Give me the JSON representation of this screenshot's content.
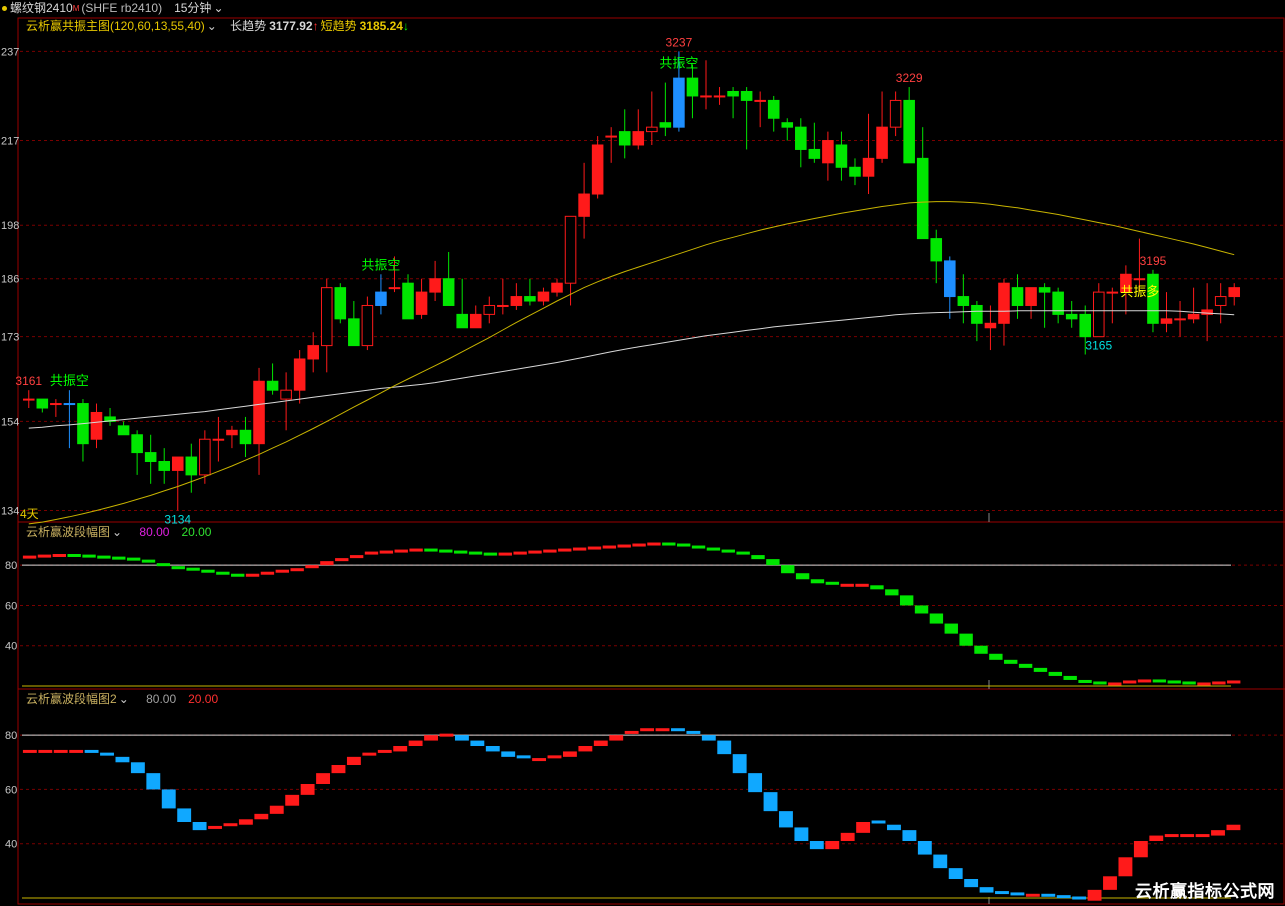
{
  "topbar": {
    "symbol": "螺纹钢2410",
    "superscript": "M",
    "code": "(SHFE rb2410)",
    "period": "15分钟"
  },
  "panel1": {
    "title": "云析赢共振主图",
    "params": "(120,60,13,55,40)",
    "long_label": "长趋势",
    "long_value": "3177.92",
    "long_arrow": "↑",
    "short_label": "短趋势",
    "short_value": "3185.24",
    "short_arrow": "↓",
    "days_label": "4天"
  },
  "panel2": {
    "title": "云析赢波段幅图",
    "v1": "80.00",
    "v2": "20.00"
  },
  "panel3": {
    "title": "云析赢波段幅图2",
    "v1": "80.00",
    "v2": "20.00"
  },
  "watermark": "云析赢指标公式网",
  "colors": {
    "up": "#ff1a1a",
    "down": "#00e600",
    "resonance": "#1e8fff",
    "long_line": "#d8d8d8",
    "short_line": "#c8b400",
    "osc2_up": "#ff1a1a",
    "osc2_dn": "#00e600",
    "osc3_up": "#ff1a1a",
    "osc3_dn": "#10a8ff",
    "grid": "#7a0000",
    "axis": "#9a0000"
  },
  "chart_data": [
    {
      "type": "candlestick",
      "title": "云析赢共振主图",
      "y_ticks": [
        3134,
        3154,
        3173,
        3186,
        3198,
        3217,
        3237
      ],
      "y_tick_labels": [
        "134",
        "154",
        "173",
        "186",
        "198",
        "217",
        "237"
      ],
      "ylim": [
        3133,
        3240
      ],
      "series": [
        {
          "name": "candles",
          "ohlc": [
            [
              3159,
              3161,
              3157,
              3159
            ],
            [
              3159,
              3159,
              3156,
              3157
            ],
            [
              3158,
              3159,
              3155,
              3158
            ],
            [
              3158,
              3161,
              3148,
              3158
            ],
            [
              3158,
              3159,
              3145,
              3149
            ],
            [
              3150,
              3158,
              3148,
              3156
            ],
            [
              3155,
              3157,
              3153,
              3154
            ],
            [
              3153,
              3154,
              3151,
              3151
            ],
            [
              3151,
              3152,
              3142,
              3147
            ],
            [
              3147,
              3151,
              3140,
              3145
            ],
            [
              3145,
              3148,
              3140,
              3143
            ],
            [
              3143,
              3146,
              3134,
              3146
            ],
            [
              3146,
              3149,
              3138,
              3142
            ],
            [
              3142,
              3152,
              3140,
              3150
            ],
            [
              3150,
              3155,
              3145,
              3150
            ],
            [
              3151,
              3153,
              3148,
              3152
            ],
            [
              3152,
              3155,
              3146,
              3149
            ],
            [
              3149,
              3166,
              3142,
              3163
            ],
            [
              3163,
              3167,
              3160,
              3161
            ],
            [
              3159,
              3165,
              3152,
              3161
            ],
            [
              3161,
              3170,
              3158,
              3168
            ],
            [
              3168,
              3174,
              3165,
              3171
            ],
            [
              3171,
              3186,
              3165,
              3184
            ],
            [
              3184,
              3185,
              3176,
              3177
            ],
            [
              3177,
              3181,
              3171,
              3171
            ],
            [
              3171,
              3182,
              3170,
              3180
            ],
            [
              3180,
              3187,
              3178,
              3183
            ],
            [
              3184,
              3191,
              3183,
              3184
            ],
            [
              3185,
              3187,
              3180,
              3177
            ],
            [
              3178,
              3186,
              3177,
              3183
            ],
            [
              3183,
              3190,
              3181,
              3186
            ],
            [
              3186,
              3192,
              3182,
              3180
            ],
            [
              3178,
              3186,
              3175,
              3175
            ],
            [
              3175,
              3180,
              3175,
              3178
            ],
            [
              3178,
              3182,
              3176,
              3180
            ],
            [
              3180,
              3186,
              3178,
              3180
            ],
            [
              3180,
              3185,
              3179,
              3182
            ],
            [
              3182,
              3186,
              3180,
              3181
            ],
            [
              3181,
              3184,
              3180,
              3183
            ],
            [
              3183,
              3186,
              3182,
              3185
            ],
            [
              3185,
              3200,
              3180,
              3200
            ],
            [
              3200,
              3212,
              3195,
              3205
            ],
            [
              3205,
              3218,
              3204,
              3216
            ],
            [
              3218,
              3220,
              3212,
              3218
            ],
            [
              3219,
              3224,
              3213,
              3216
            ],
            [
              3216,
              3224,
              3215,
              3219
            ],
            [
              3219,
              3228,
              3216,
              3220
            ],
            [
              3221,
              3230,
              3218,
              3220
            ],
            [
              3220,
              3237,
              3219,
              3231
            ],
            [
              3231,
              3234,
              3222,
              3227
            ],
            [
              3227,
              3235,
              3224,
              3227
            ],
            [
              3227,
              3229,
              3225,
              3227
            ],
            [
              3228,
              3229,
              3222,
              3227
            ],
            [
              3228,
              3229,
              3215,
              3226
            ],
            [
              3226,
              3228,
              3220,
              3226
            ],
            [
              3226,
              3227,
              3219,
              3222
            ],
            [
              3221,
              3222,
              3217,
              3220
            ],
            [
              3220,
              3222,
              3211,
              3215
            ],
            [
              3215,
              3221,
              3212,
              3213
            ],
            [
              3212,
              3219,
              3208,
              3217
            ],
            [
              3216,
              3219,
              3208,
              3211
            ],
            [
              3211,
              3213,
              3207,
              3209
            ],
            [
              3209,
              3223,
              3205,
              3213
            ],
            [
              3213,
              3228,
              3212,
              3220
            ],
            [
              3220,
              3228,
              3218,
              3226
            ],
            [
              3226,
              3229,
              3214,
              3212
            ],
            [
              3213,
              3220,
              3195,
              3195
            ],
            [
              3195,
              3197,
              3185,
              3190
            ],
            [
              3190,
              3191,
              3177,
              3182
            ],
            [
              3182,
              3187,
              3176,
              3180
            ],
            [
              3180,
              3181,
              3172,
              3176
            ],
            [
              3175,
              3180,
              3170,
              3176
            ],
            [
              3176,
              3186,
              3171,
              3185
            ],
            [
              3184,
              3187,
              3177,
              3180
            ],
            [
              3180,
              3183,
              3177,
              3184
            ],
            [
              3184,
              3185,
              3175,
              3183
            ],
            [
              3183,
              3184,
              3176,
              3178
            ],
            [
              3178,
              3181,
              3175,
              3177
            ],
            [
              3178,
              3180,
              3169,
              3173
            ],
            [
              3173,
              3185,
              3173,
              3183
            ],
            [
              3183,
              3184,
              3176,
              3183
            ],
            [
              3183,
              3189,
              3178,
              3187
            ],
            [
              3186,
              3195,
              3183,
              3186
            ],
            [
              3187,
              3188,
              3174,
              3176
            ],
            [
              3176,
              3183,
              3174,
              3177
            ],
            [
              3177,
              3181,
              3173,
              3177
            ],
            [
              3177,
              3184,
              3176,
              3178
            ],
            [
              3178,
              3185,
              3172,
              3179
            ],
            [
              3180,
              3185,
              3176,
              3182
            ],
            [
              3182,
              3185,
              3180,
              3184
            ]
          ]
        },
        {
          "name": "长趋势",
          "values": [
            3152.5,
            3152.7,
            3153.0,
            3153.2,
            3153.5,
            3153.8,
            3154.1,
            3154.4,
            3154.7,
            3155.0,
            3155.3,
            3155.6,
            3155.9,
            3156.2,
            3156.6,
            3157.0,
            3157.4,
            3157.8,
            3158.2,
            3158.6,
            3159.0,
            3159.4,
            3159.8,
            3160.2,
            3160.6,
            3161.0,
            3161.4,
            3161.7,
            3162.0,
            3162.3,
            3162.7,
            3163.2,
            3163.7,
            3164.2,
            3164.7,
            3165.2,
            3165.7,
            3166.2,
            3166.7,
            3167.2,
            3167.8,
            3168.4,
            3169.0,
            3169.6,
            3170.2,
            3170.7,
            3171.2,
            3171.7,
            3172.2,
            3172.7,
            3173.2,
            3173.6,
            3174.0,
            3174.4,
            3174.8,
            3175.2,
            3175.5,
            3175.8,
            3176.1,
            3176.4,
            3176.7,
            3177.0,
            3177.3,
            3177.6,
            3177.9,
            3178.1,
            3178.3,
            3178.4,
            3178.5,
            3178.6,
            3178.7,
            3178.7,
            3178.7,
            3178.8,
            3178.8,
            3178.8,
            3178.8,
            3178.8,
            3178.8,
            3178.8,
            3178.8,
            3178.8,
            3178.8,
            3178.8,
            3178.8,
            3178.7,
            3178.5,
            3178.3,
            3178.1,
            3177.9
          ]
        },
        {
          "name": "短趋势",
          "values": [
            3131,
            3131.4,
            3132,
            3132.6,
            3133.3,
            3134,
            3134.8,
            3135.6,
            3136.5,
            3137.4,
            3138.4,
            3139.4,
            3140.5,
            3141.6,
            3142.8,
            3144,
            3145.3,
            3146.6,
            3148,
            3149.4,
            3150.9,
            3152.4,
            3154,
            3155.6,
            3157.2,
            3158.8,
            3160.4,
            3162,
            3163.5,
            3165,
            3166.5,
            3168,
            3169.6,
            3171.2,
            3172.8,
            3174.5,
            3176.2,
            3177.8,
            3179.4,
            3181,
            3182.5,
            3184,
            3185.3,
            3186.5,
            3187.6,
            3188.6,
            3189.6,
            3190.6,
            3191.6,
            3192.6,
            3193.6,
            3194.5,
            3195.3,
            3196.1,
            3196.9,
            3197.6,
            3198.3,
            3198.9,
            3199.5,
            3200.1,
            3200.7,
            3201.2,
            3201.7,
            3202.2,
            3202.6,
            3203,
            3203.2,
            3203.3,
            3203.3,
            3203.2,
            3203,
            3202.7,
            3202.3,
            3201.9,
            3201.4,
            3200.9,
            3200.4,
            3199.8,
            3199.2,
            3198.6,
            3198,
            3197.3,
            3196.6,
            3195.9,
            3195.2,
            3194.5,
            3193.8,
            3193,
            3192.2,
            3191.4
          ]
        }
      ],
      "resonance_candles": [
        3,
        26,
        48,
        68
      ],
      "annotations": [
        {
          "i": 0,
          "text": "3161",
          "pos": "above",
          "color": "#ff4040"
        },
        {
          "i": 3,
          "text": "共振空",
          "pos": "above",
          "color": "#00ff00"
        },
        {
          "i": 11,
          "text": "3134",
          "pos": "below",
          "color": "#00e0e0"
        },
        {
          "i": 26,
          "text": "共振空",
          "pos": "above",
          "color": "#00ff00"
        },
        {
          "i": 48,
          "text": "3237",
          "pos": "above",
          "color": "#ff4040"
        },
        {
          "i": 48,
          "text": "共振空",
          "pos": "above2",
          "color": "#00ff00"
        },
        {
          "i": 65,
          "text": "3229",
          "pos": "above",
          "color": "#ff4040"
        },
        {
          "i": 79,
          "text": "3165",
          "pos": "below",
          "color": "#00e0e0"
        },
        {
          "i": 80,
          "text": "共振多",
          "pos": "right",
          "color": "#ffff00"
        },
        {
          "i": 83,
          "text": "3195",
          "pos": "above",
          "color": "#ff4040"
        }
      ]
    },
    {
      "type": "bar",
      "title": "云析赢波段幅图",
      "y_ticks": [
        40,
        60,
        80
      ],
      "ylim": [
        20,
        92
      ],
      "reference_lines": [
        80,
        20
      ],
      "values": [
        84,
        84.5,
        84.8,
        84.5,
        84,
        83.5,
        83,
        82,
        81,
        79.5,
        78,
        77,
        76,
        75,
        74.5,
        75,
        76,
        77,
        78.5,
        80,
        82,
        83.5,
        85,
        86,
        86.5,
        87,
        87.5,
        87,
        86.5,
        86,
        85.5,
        85,
        85.5,
        86,
        86.5,
        87,
        87.5,
        88,
        88.5,
        89,
        89.5,
        90,
        90.5,
        90,
        89,
        88,
        87,
        86,
        85,
        83,
        80,
        76,
        73,
        71,
        70,
        70,
        70,
        68,
        65,
        60,
        56,
        51,
        46,
        40,
        36,
        33,
        31,
        29,
        27,
        25,
        23,
        21.5,
        21,
        21,
        22,
        22.5,
        22,
        21.5,
        21,
        21,
        21.5,
        22
      ]
    },
    {
      "type": "bar",
      "title": "云析赢波段幅图2",
      "y_ticks": [
        40,
        60,
        80
      ],
      "ylim": [
        20,
        90
      ],
      "reference_lines": [
        80,
        20
      ],
      "values": [
        74,
        74,
        74,
        74,
        73,
        72,
        70,
        66,
        60,
        53,
        48,
        45,
        46,
        47,
        49,
        51,
        54,
        58,
        62,
        66,
        69,
        72,
        73,
        74,
        76,
        78,
        80,
        80,
        78,
        76,
        74,
        72,
        71,
        71,
        72,
        74,
        76,
        78,
        80,
        81,
        82,
        82,
        81,
        80,
        78,
        73,
        66,
        59,
        52,
        46,
        41,
        38,
        41,
        44,
        48,
        47,
        45,
        41,
        36,
        31,
        27,
        24,
        22,
        21.5,
        21,
        21,
        20.5,
        20,
        19,
        23,
        28,
        35,
        41,
        43,
        43,
        43,
        43,
        45,
        47
      ]
    }
  ]
}
